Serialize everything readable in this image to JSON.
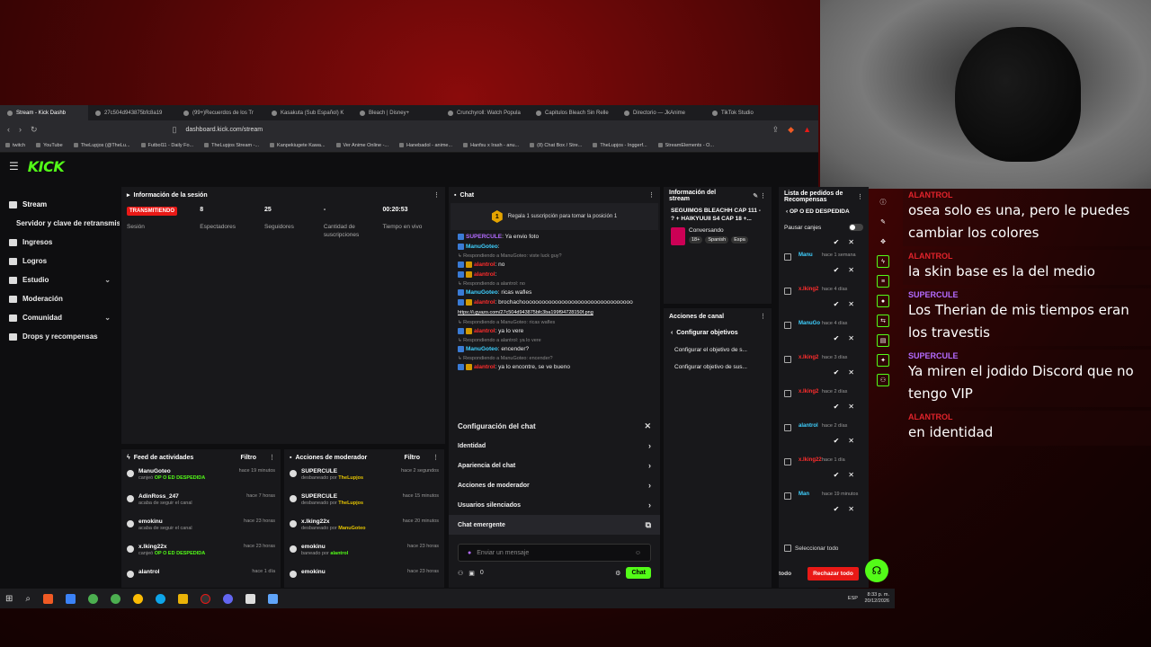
{
  "browser": {
    "tabs": [
      "Stream - Kick Dashb",
      "27c504d943875bfc8a19",
      "(99+)Recuerdos de los Tr",
      "Kasakuta (Sub Español) K",
      "Bleach | Disney+",
      "Crunchyroll: Watch Popula",
      "Capitulos Bleach Sin Relle",
      "Directorio — JkAnime",
      "TikTok Studio"
    ],
    "url": "dashboard.kick.com/stream",
    "bookmarks": [
      "twitch",
      "YouTube",
      "TheLupjos (@TheLu...",
      "Futbol11 - Daily Fo...",
      "TheLupjos Stream -...",
      "Kanpekiugete Kawa...",
      "Ver Anime Online -...",
      "Hanebadol - anime...",
      "Hanfsu x Irash - anu...",
      "(8) Chat Box / Stre...",
      "TheLupjos - Inggerf...",
      "StreamElements - O..."
    ]
  },
  "brand": {
    "logo": "KICK",
    "accent": "#53fc18",
    "live": "#e91916"
  },
  "sidebar": {
    "items": [
      {
        "label": "Stream",
        "icon": "broadcast-icon"
      },
      {
        "label": "Servidor y clave de retransmisión",
        "icon": ""
      },
      {
        "label": "Ingresos",
        "icon": "dollar-icon"
      },
      {
        "label": "Logros",
        "icon": "trophy-icon"
      },
      {
        "label": "Estudio",
        "icon": "studio-icon"
      },
      {
        "label": "Moderación",
        "icon": "wrench-icon"
      },
      {
        "label": "Comunidad",
        "icon": "community-icon"
      },
      {
        "label": "Drops y recompensas",
        "icon": "gift-icon"
      }
    ]
  },
  "session": {
    "title": "Información de la sesión",
    "status": "TRANSMITIENDO",
    "status_label": "Sesión",
    "viewers": "8",
    "viewers_label": "Espectadores",
    "followers": "25",
    "followers_label": "Seguidores",
    "subs": "-",
    "subs_label": "Cantidad de suscripciones",
    "time": "00:20:53",
    "time_label": "Tiempo en vivo"
  },
  "chat": {
    "title": "Chat",
    "pinned": "Regala 1 suscripción para tomar la posición 1",
    "pinned_rank": "1",
    "messages": [
      {
        "reply": "",
        "user": "SUPERCULE",
        "color": "#b36bff",
        "text": "Ya envio foto"
      },
      {
        "reply": "",
        "user": "ManuGoteo",
        "color": "#3fd0ff",
        "text": ""
      },
      {
        "reply": "Respondiendo a ManuGoteo: viste luck guy?",
        "user": "alantrol",
        "color": "#ff2d2d",
        "text": "no"
      },
      {
        "reply": "",
        "user": "alantrol",
        "color": "#ff2d2d",
        "text": ""
      },
      {
        "reply": "Respondiendo a alantrol: no",
        "user": "ManuGoteo",
        "color": "#3fd0ff",
        "text": "ricas wafles"
      },
      {
        "reply": "",
        "user": "alantrol",
        "color": "#ff2d2d",
        "text": "brochachoooooooooooooooooooooooooooooooooo"
      },
      {
        "reply": "",
        "user": "",
        "color": "#3fd0ff",
        "text": "https://i.gyazo.com/27c504d943875bfc3ba199f94728150f.png"
      },
      {
        "reply": "Respondiendo a ManuGoteo: ricas wafles",
        "user": "alantrol",
        "color": "#ff2d2d",
        "text": "ya lo vere"
      },
      {
        "reply": "Respondiendo a alantrol: ya lo vere",
        "user": "ManuGoteo",
        "color": "#3fd0ff",
        "text": "encender?"
      },
      {
        "reply": "Respondiendo a ManuGoteo: encender?",
        "user": "alantrol",
        "color": "#ff2d2d",
        "text": "ya lo encontre, se ve bueno"
      }
    ],
    "config_title": "Configuración del chat",
    "config_items": [
      "Identidad",
      "Apariencia del chat",
      "Acciones de moderador",
      "Usuarios silenciados",
      "Chat emergente"
    ],
    "input_placeholder": "Enviar un mensaje",
    "send_label": "Chat",
    "count": "0"
  },
  "stream_info": {
    "title": "Información del stream",
    "stream_title": "SEGUIMOS BLEACHH CAP 111 - ? + HAIKYUUII S4 CAP 18 +...",
    "category": "Conversando",
    "tags": [
      "18+",
      "Spanish",
      "Espa"
    ]
  },
  "channel_actions": {
    "title": "Acciones de canal",
    "back": "Configurar objetivos",
    "items": [
      "Configurar el objetivo de s...",
      "Configurar objetivo de sus..."
    ]
  },
  "rewards": {
    "title": "Lista de pedidos de Recompensas",
    "reward_name": "OP O ED DESPEDIDA",
    "pause_label": "Pausar canjes",
    "rows": [
      {
        "user": "Manu",
        "color": "#3fd0ff",
        "time": "hace 1 semana"
      },
      {
        "user": "x.lking2",
        "color": "#ff2d2d",
        "time": "hace 4 días"
      },
      {
        "user": "ManuGo",
        "color": "#3fd0ff",
        "time": "hace 4 días"
      },
      {
        "user": "x.lking2",
        "color": "#ff2d2d",
        "time": "hace 3 días"
      },
      {
        "user": "x.lking2",
        "color": "#ff2d2d",
        "time": "hace 2 días"
      },
      {
        "user": "alantrol",
        "color": "#3fd0ff",
        "time": "hace 2 días"
      },
      {
        "user": "x.lking22",
        "color": "#ff2d2d",
        "time": "hace 1 día"
      },
      {
        "user": "Man",
        "color": "#3fd0ff",
        "time": "hace 19 minutos"
      }
    ],
    "select_all": "Seleccionar todo",
    "approve_all": "todo",
    "reject_all": "Rechazar todo"
  },
  "feed": {
    "title": "Feed de actividades",
    "filter": "Filtro",
    "rows": [
      {
        "user": "ManuGoteo",
        "desc": "canjeó",
        "highlight": "OP O ED DESPEDIDA",
        "time": "hace 19 minutos",
        "icon": "reward-icon"
      },
      {
        "user": "AdinRoss_247",
        "desc": "acaba de seguir el canal",
        "highlight": "",
        "time": "hace 7 horas",
        "icon": "heart-icon"
      },
      {
        "user": "emokinu",
        "desc": "acaba de seguir el canal",
        "highlight": "",
        "time": "hace 23 horas",
        "icon": "heart-icon"
      },
      {
        "user": "x.lking22x",
        "desc": "canjeó",
        "highlight": "OP O ED DESPEDIDA",
        "time": "hace 23 horas",
        "icon": "reward-icon"
      },
      {
        "user": "alantrol",
        "desc": "",
        "highlight": "",
        "time": "hace 1 día",
        "icon": "reward-icon"
      }
    ]
  },
  "mod_actions": {
    "title": "Acciones de moderador",
    "filter": "Filtro",
    "rows": [
      {
        "user": "SUPERCULE",
        "desc": "desbaneado por",
        "by": "TheLupjos",
        "time": "hace 2 segundos"
      },
      {
        "user": "SUPERCULE",
        "desc": "desbaneado por",
        "by": "TheLupjos",
        "time": "hace 15 minutos"
      },
      {
        "user": "x.lking22x",
        "desc": "desbaneado por",
        "by": "ManuGoteo",
        "time": "hace 20 minutos"
      },
      {
        "user": "emokinu",
        "desc": "baneado por",
        "by": "alantrol",
        "time": "hace 23 horas"
      },
      {
        "user": "emokinu",
        "desc": "",
        "by": "",
        "time": "hace 23 horas"
      }
    ]
  },
  "overlay_chat": [
    {
      "user": "ALANTROL",
      "color": "#e0232b",
      "text": "osea solo es una, pero le puedes cambiar los colores"
    },
    {
      "user": "ALANTROL",
      "color": "#e0232b",
      "text": "la skin base es la del medio"
    },
    {
      "user": "SUPERCULE",
      "color": "#b36bff",
      "text": "Los Therian de mis tiempos eran los travestis"
    },
    {
      "user": "SUPERCULE",
      "color": "#b36bff",
      "text": "Ya miren el jodido Discord que no tengo VIP"
    },
    {
      "user": "ALANTROL",
      "color": "#e0232b",
      "text": "en identidad"
    }
  ],
  "taskbar": {
    "lang": "ESP",
    "time": "8:33 p. m.",
    "date": "20/12/2026"
  }
}
